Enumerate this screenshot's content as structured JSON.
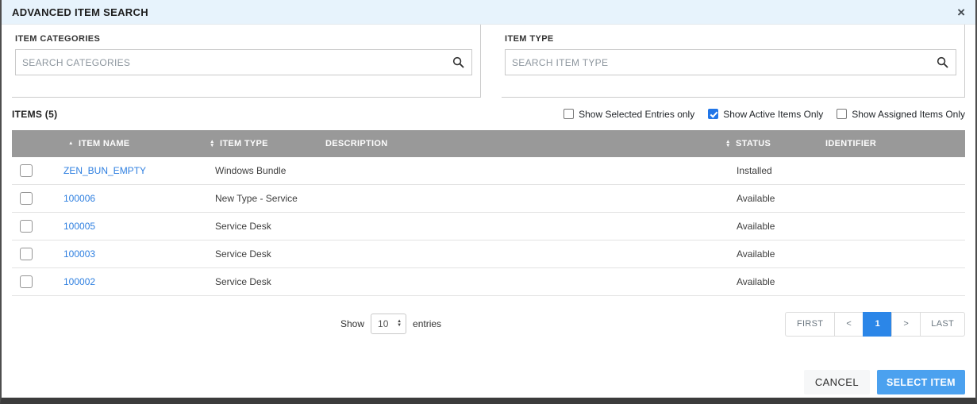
{
  "dialog": {
    "title": "ADVANCED ITEM SEARCH",
    "close_icon": "×"
  },
  "search_panels": {
    "categories": {
      "label": "ITEM CATEGORIES",
      "placeholder": "SEARCH CATEGORIES",
      "value": ""
    },
    "item_type": {
      "label": "ITEM TYPE",
      "placeholder": "SEARCH ITEM TYPE",
      "value": ""
    }
  },
  "items_section": {
    "count_label": "ITEMS (5)",
    "filters": [
      {
        "label": "Show Selected Entries only",
        "checked": false
      },
      {
        "label": "Show Active Items Only",
        "checked": true
      },
      {
        "label": "Show Assigned Items Only",
        "checked": false
      }
    ]
  },
  "table": {
    "columns": [
      {
        "label": "",
        "sort_up": "",
        "sort_down": ""
      },
      {
        "label": "ITEM NAME",
        "sort_up": "▲",
        "sort_down": ""
      },
      {
        "label": "ITEM TYPE",
        "sort_up": "▲",
        "sort_down": "▼"
      },
      {
        "label": "DESCRIPTION",
        "sort_up": "",
        "sort_down": ""
      },
      {
        "label": "STATUS",
        "sort_up": "▲",
        "sort_down": "▼"
      },
      {
        "label": "IDENTIFIER",
        "sort_up": "",
        "sort_down": ""
      }
    ],
    "rows": [
      {
        "name": "ZEN_BUN_EMPTY",
        "type": "Windows Bundle",
        "description": "",
        "status": "Installed",
        "identifier": "",
        "checked": false
      },
      {
        "name": "100006",
        "type": "New Type - Service",
        "description": "",
        "status": "Available",
        "identifier": "",
        "checked": false
      },
      {
        "name": "100005",
        "type": "Service Desk",
        "description": "",
        "status": "Available",
        "identifier": "",
        "checked": false
      },
      {
        "name": "100003",
        "type": "Service Desk",
        "description": "",
        "status": "Available",
        "identifier": "",
        "checked": false
      },
      {
        "name": "100002",
        "type": "Service Desk",
        "description": "",
        "status": "Available",
        "identifier": "",
        "checked": false
      }
    ]
  },
  "pagination": {
    "show_label": "Show",
    "page_size": "10",
    "entries_label": "entries",
    "first_label": "FIRST",
    "prev_label": "<",
    "page": "1",
    "next_label": ">",
    "last_label": "LAST"
  },
  "footer": {
    "cancel_label": "CANCEL",
    "select_label": "SELECT ITEM"
  },
  "colors": {
    "header_bg": "#e7f3fc",
    "table_header_bg": "#999999",
    "link_blue": "#2e7fe0",
    "checkbox_blue": "#2176e8",
    "active_page_blue": "#2b86e8",
    "select_button_blue": "#4ba1ef"
  }
}
